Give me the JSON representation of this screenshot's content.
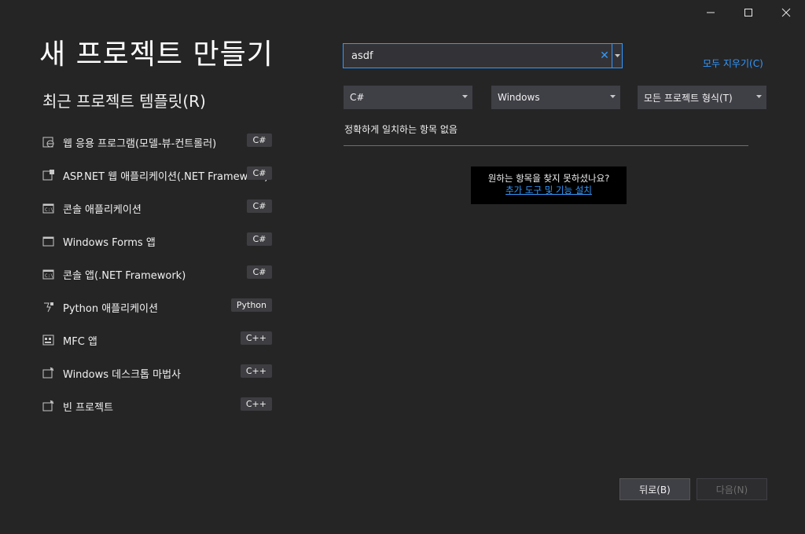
{
  "window": {
    "minimize_icon": "minimize-icon",
    "maximize_icon": "maximize-icon",
    "close_icon": "close-icon"
  },
  "page_title": "새 프로젝트 만들기",
  "recent": {
    "title": "최근 프로젝트 템플릿(R)",
    "items": [
      {
        "label": "웹 응용 프로그램(모델-뷰-컨트롤러)",
        "lang": "C#",
        "icon": "web-app-icon"
      },
      {
        "label": "ASP.NET 웹 애플리케이션(.NET Framework)",
        "lang": "C#",
        "icon": "aspnet-icon"
      },
      {
        "label": "콘솔 애플리케이션",
        "lang": "C#",
        "icon": "console-icon"
      },
      {
        "label": "Windows Forms 앱",
        "lang": "C#",
        "icon": "winforms-icon"
      },
      {
        "label": "콘솔 앱(.NET Framework)",
        "lang": "C#",
        "icon": "console-icon"
      },
      {
        "label": "Python 애플리케이션",
        "lang": "Python",
        "icon": "python-icon"
      },
      {
        "label": "MFC 앱",
        "lang": "C++",
        "icon": "mfc-icon"
      },
      {
        "label": "Windows 데스크톱 마법사",
        "lang": "C++",
        "icon": "desktop-wizard-icon"
      },
      {
        "label": "빈 프로젝트",
        "lang": "C++",
        "icon": "empty-project-icon"
      }
    ]
  },
  "search": {
    "value": "asdf",
    "clear_icon": "clear-icon",
    "dropdown_icon": "chevron-down-icon"
  },
  "clear_all": "모두 지우기(C)",
  "filters": {
    "language": "C#",
    "platform": "Windows",
    "project_type": "모든 프로젝트 형식(T)"
  },
  "results": {
    "no_match": "정확하게 일치하는 항목 없음",
    "hint_question": "원하는 항목을 찾지 못하셨나요?",
    "hint_link": "추가 도구 및 기능 설치"
  },
  "footer": {
    "back": "뒤로(B)",
    "next": "다음(N)"
  },
  "colors": {
    "background": "#252526",
    "accent": "#3399ff",
    "control": "#3f3f46"
  }
}
